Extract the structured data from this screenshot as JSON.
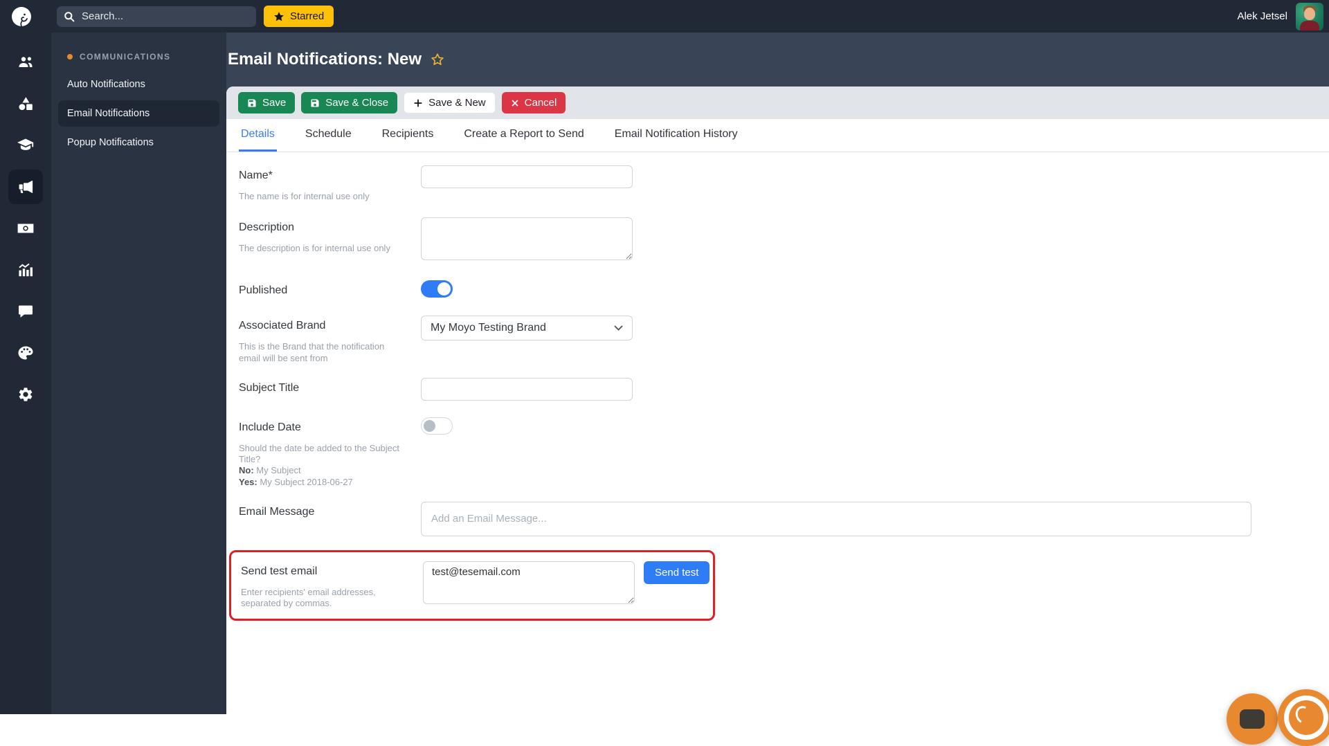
{
  "colors": {
    "topbar_bg": "#212936",
    "sidebar_bg": "#2a3342",
    "main_bg": "#3a4457",
    "accent_orange": "#e8872d",
    "starred_yellow": "#ffc107",
    "save_green": "#198754",
    "cancel_red": "#dc3545",
    "action_blue": "#2e7df6",
    "tab_active_blue": "#3b7cf0",
    "highlight_red": "#e01e24"
  },
  "topbar": {
    "logo_icon": "elephant-logo",
    "search_placeholder": "Search...",
    "starred_label": "Starred",
    "user_name": "Alek Jetsel"
  },
  "rail": {
    "icons": [
      "users",
      "shapes",
      "graduation-cap",
      "megaphone",
      "money",
      "chart",
      "chat",
      "palette",
      "gear"
    ],
    "active_icon": "megaphone"
  },
  "sidebar": {
    "section": "COMMUNICATIONS",
    "items": [
      {
        "label": "Auto Notifications"
      },
      {
        "label": "Email Notifications"
      },
      {
        "label": "Popup Notifications"
      }
    ],
    "active_item": "Email Notifications"
  },
  "page": {
    "title": "Email Notifications: New"
  },
  "toolbar": {
    "save": "Save",
    "save_and_close": "Save & Close",
    "save_and_new": "Save & New",
    "cancel": "Cancel"
  },
  "tabs": {
    "active": "Details",
    "items": [
      {
        "label": "Details"
      },
      {
        "label": "Schedule"
      },
      {
        "label": "Recipients"
      },
      {
        "label": "Create a Report to Send"
      },
      {
        "label": "Email Notification History"
      }
    ]
  },
  "form": {
    "name": {
      "label": "Name*",
      "help": "The name is for internal use only",
      "value": ""
    },
    "description": {
      "label": "Description",
      "help": "The description is for internal use only",
      "value": ""
    },
    "published": {
      "label": "Published",
      "state": "on"
    },
    "associated_brand": {
      "label": "Associated Brand",
      "help": "This is the Brand that the notification email will be sent from",
      "value": "My Moyo Testing Brand"
    },
    "subject_title": {
      "label": "Subject Title",
      "value": ""
    },
    "include_date": {
      "label": "Include Date",
      "state": "off",
      "help": "Should the date be added to the Subject Title?",
      "example_no_label": "No:",
      "example_no": "My Subject",
      "example_yes_label": "Yes:",
      "example_yes": "My Subject 2018-06-27"
    },
    "email_message": {
      "label": "Email Message",
      "placeholder": "Add an Email Message..."
    },
    "send_test": {
      "label": "Send test email",
      "help": "Enter recipients' email addresses, separated by commas.",
      "value": "test@tesemail.com",
      "button_label": "Send test"
    }
  }
}
